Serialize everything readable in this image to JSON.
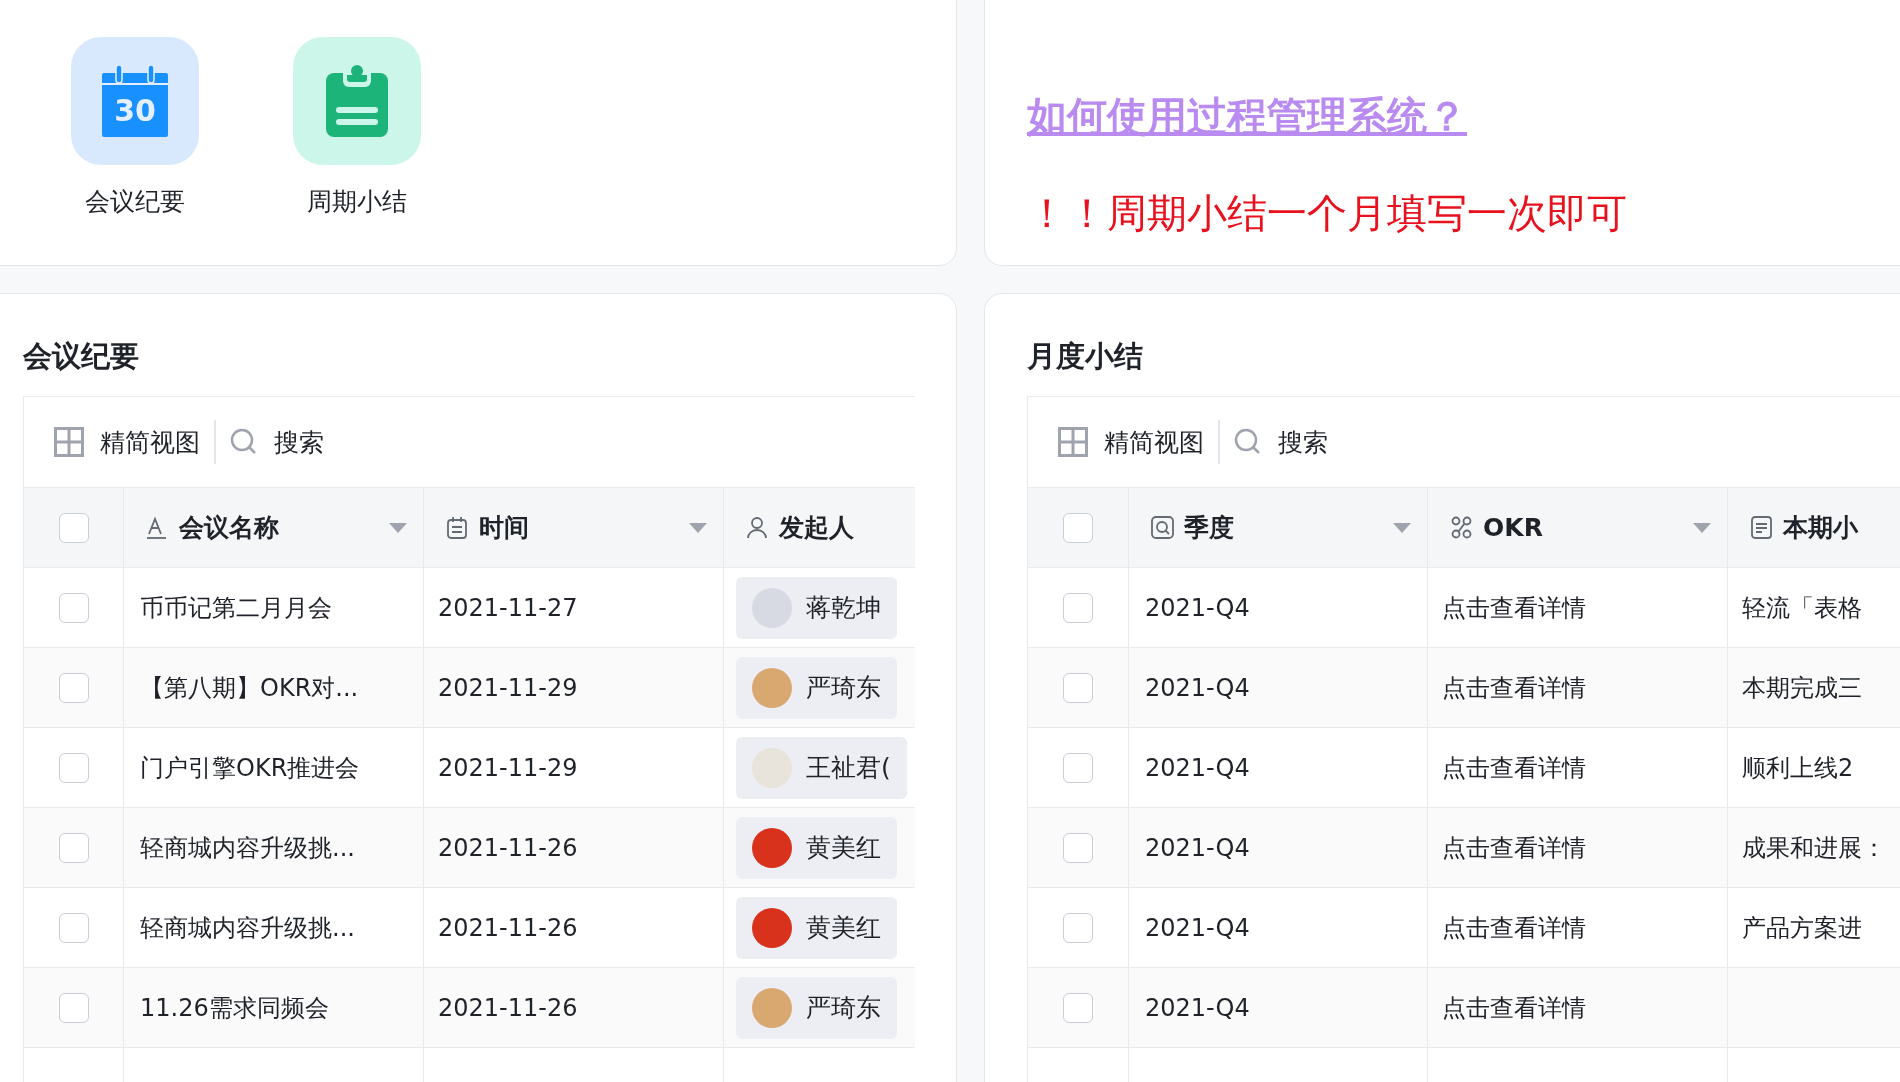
{
  "shortcuts": [
    {
      "label": "会议纪要",
      "kind": "calendar",
      "icon_text": "30"
    },
    {
      "label": "周期小结",
      "kind": "clipboard"
    }
  ],
  "notice": {
    "link": "如何使用过程管理系统？",
    "alert": "！！周期小结一个月填写一次即可"
  },
  "tables": [
    {
      "title": "会议纪要",
      "toolbar": {
        "view": "精简视图",
        "search": "搜索"
      },
      "header_checked": false,
      "columns": [
        {
          "label": "会议名称",
          "kind": "text",
          "dropdown": true
        },
        {
          "label": "时间",
          "kind": "date",
          "dropdown": true
        },
        {
          "label": "发起人",
          "kind": "person"
        }
      ],
      "rows": [
        {
          "checked": false,
          "cells": [
            "币币记第二月月会",
            "2021-11-27",
            {
              "name": "蒋乾坤",
              "color": "#d8dae3"
            }
          ]
        },
        {
          "checked": false,
          "cells": [
            "【第八期】OKR对...",
            "2021-11-29",
            {
              "name": "严琦东",
              "color": "#d9a870"
            }
          ]
        },
        {
          "checked": false,
          "cells": [
            "门户引擎OKR推进会",
            "2021-11-29",
            {
              "name": "王祉君(",
              "color": "#e8e4dc"
            }
          ]
        },
        {
          "checked": false,
          "cells": [
            "轻商城内容升级挑...",
            "2021-11-26",
            {
              "name": "黄美红",
              "color": "#d8321c"
            }
          ]
        },
        {
          "checked": false,
          "cells": [
            "轻商城内容升级挑...",
            "2021-11-26",
            {
              "name": "黄美红",
              "color": "#d8321c"
            }
          ]
        },
        {
          "checked": false,
          "cells": [
            "11.26需求同频会",
            "2021-11-26",
            {
              "name": "严琦东",
              "color": "#d9a870"
            }
          ]
        }
      ]
    },
    {
      "title": "月度小结",
      "toolbar": {
        "view": "精简视图",
        "search": "搜索"
      },
      "header_checked": false,
      "columns": [
        {
          "label": "季度",
          "kind": "quarter",
          "dropdown": true
        },
        {
          "label": "OKR",
          "kind": "relation",
          "dropdown": true
        },
        {
          "label": "本期小",
          "kind": "doc"
        }
      ],
      "rows": [
        {
          "checked": false,
          "cells": [
            "2021-Q4",
            "点击查看详情",
            "轻流「表格"
          ]
        },
        {
          "checked": false,
          "cells": [
            "2021-Q4",
            "点击查看详情",
            "本期完成三"
          ]
        },
        {
          "checked": false,
          "cells": [
            "2021-Q4",
            "点击查看详情",
            "顺利上线2"
          ]
        },
        {
          "checked": false,
          "cells": [
            "2021-Q4",
            "点击查看详情",
            "成果和进展："
          ]
        },
        {
          "checked": false,
          "cells": [
            "2021-Q4",
            "点击查看详情",
            "产品方案进"
          ]
        },
        {
          "checked": false,
          "cells": [
            "2021-Q4",
            "点击查看详情",
            null
          ]
        }
      ]
    }
  ]
}
